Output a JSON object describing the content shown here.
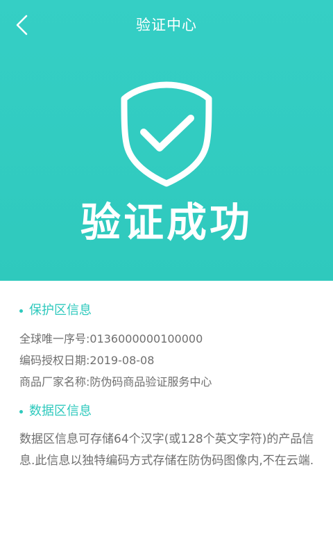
{
  "header": {
    "title": "验证中心",
    "success_text": "验证成功",
    "background": "#33ccc2",
    "icons": {
      "back": "chevron-left-icon",
      "badge": "shield-check-icon"
    }
  },
  "protect_section": {
    "title": "保护区信息",
    "items": [
      "全球唯一序号:0136000000100000",
      "编码授权日期:2019-08-08",
      "商品厂家名称:防伪码商品验证服务中心"
    ]
  },
  "data_section": {
    "title": "数据区信息",
    "description": "数据区信息可存储64个汉字(或128个英文字符)的产品信息.此信息以独特编码方式存储在防伪码图像内,不在云端."
  },
  "colors": {
    "accent": "#2ec9bd",
    "text_gray": "#6f6f6f"
  }
}
